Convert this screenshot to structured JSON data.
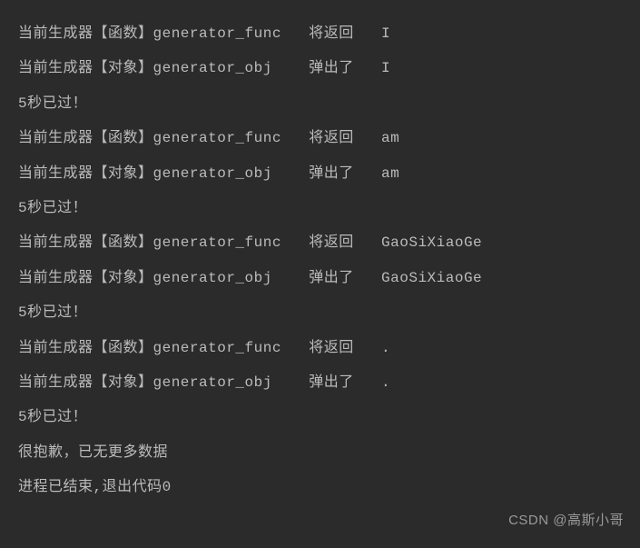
{
  "console": {
    "lines": [
      "当前生成器【函数】generator_func   将返回   I",
      "当前生成器【对象】generator_obj    弹出了   I",
      "5秒已过！",
      "当前生成器【函数】generator_func   将返回   am",
      "当前生成器【对象】generator_obj    弹出了   am",
      "5秒已过！",
      "当前生成器【函数】generator_func   将返回   GaoSiXiaoGe",
      "当前生成器【对象】generator_obj    弹出了   GaoSiXiaoGe",
      "5秒已过！",
      "当前生成器【函数】generator_func   将返回   .",
      "当前生成器【对象】generator_obj    弹出了   .",
      "5秒已过！",
      "很抱歉，已无更多数据",
      "",
      "进程已结束,退出代码0"
    ]
  },
  "watermark": {
    "text": "CSDN @高斯小哥"
  }
}
